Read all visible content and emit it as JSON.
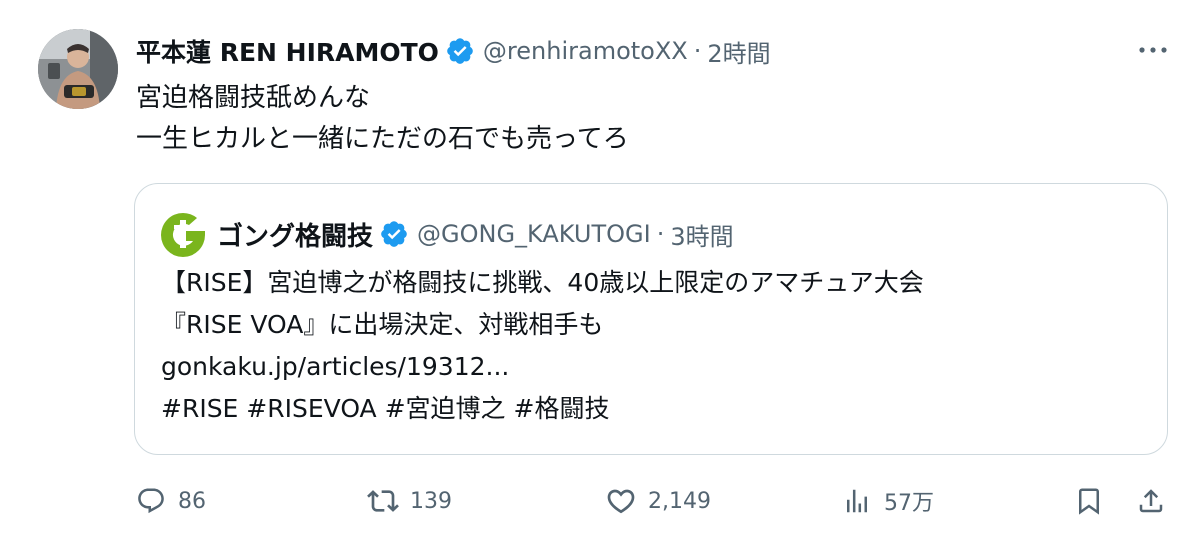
{
  "tweet": {
    "display_name": "平本蓮 REN HIRAMOTO",
    "handle": "@renhiramotoXX",
    "separator": "·",
    "time": "2時間",
    "lines": [
      "宮迫格闘技舐めんな",
      "一生ヒカルと一緒にただの石でも売ってろ"
    ]
  },
  "quote": {
    "display_name": "ゴング格闘技",
    "handle": "@GONG_KAKUTOGI",
    "separator": "·",
    "time": "3時間",
    "lines": [
      "【RISE】宮迫博之が格闘技に挑戦、40歳以上限定のアマチュア大会",
      "『RISE VOA』に出場決定、対戦相手も",
      "gonkaku.jp/articles/19312...",
      "#RISE #RISEVOA #宮迫博之 #格闘技"
    ]
  },
  "actions": {
    "replies": "86",
    "reposts": "139",
    "likes": "2,149",
    "views": "57万"
  },
  "colors": {
    "text": "#0f1419",
    "secondary": "#536471",
    "verified": "#1d9bf0",
    "border": "#cfd9de",
    "gong_green": "#7ab51d"
  },
  "icons": {
    "verified": "verified-badge-icon",
    "more": "more-dots-icon",
    "reply": "reply-bubble-icon",
    "repost": "repost-arrows-icon",
    "like": "heart-icon",
    "views": "views-bars-icon",
    "bookmark": "bookmark-icon",
    "share": "share-upload-icon"
  }
}
